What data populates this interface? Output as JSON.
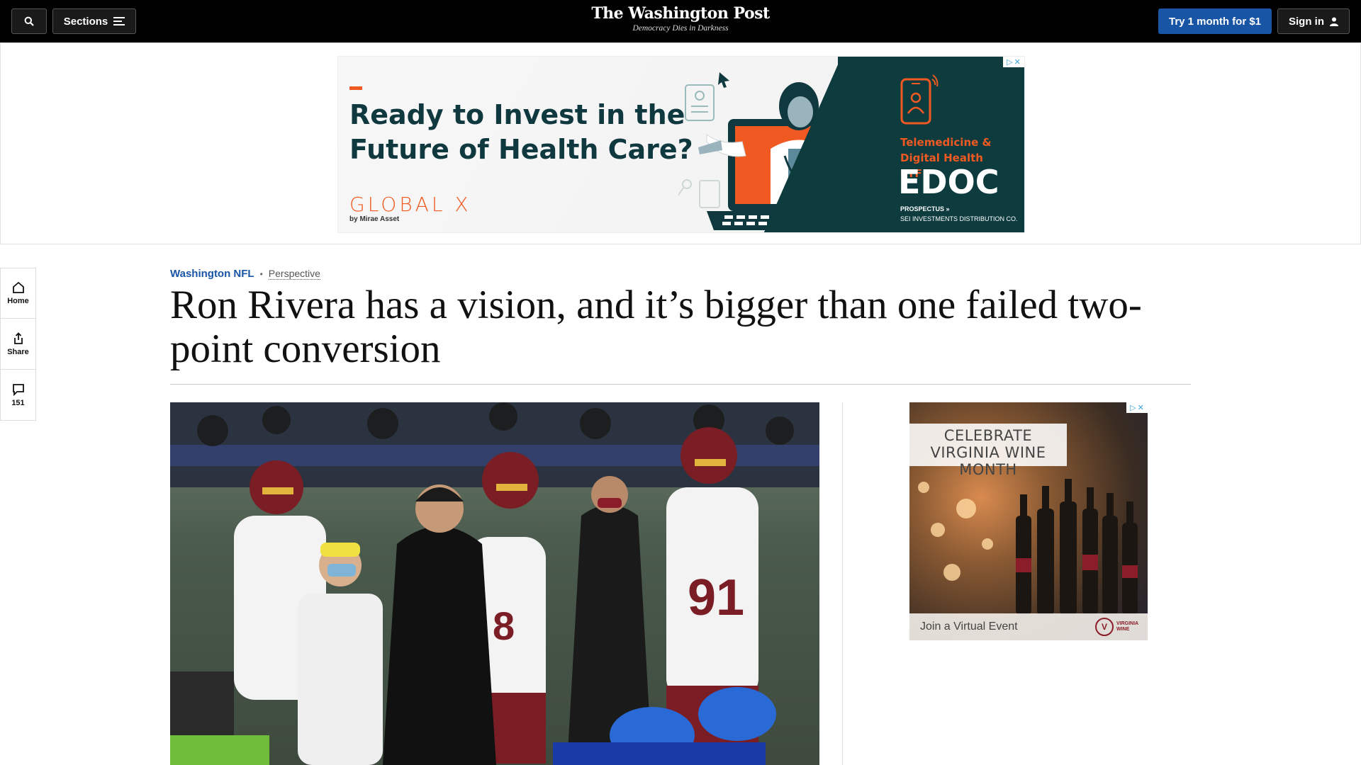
{
  "topbar": {
    "sections_label": "Sections",
    "logo": "The Washington Post",
    "tagline": "Democracy Dies in Darkness",
    "subscribe_label": "Try 1 month for $1",
    "signin_label": "Sign in"
  },
  "top_ad": {
    "headline": "Ready to Invest in the Future of Health Care?",
    "brand": "GLOBAL X",
    "brand_sub": "by Mirae Asset",
    "etf_name": "Telemedicine & Digital Health ETF",
    "ticker": "EDOC",
    "prospectus": "PROSPECTUS »",
    "distributor": "SEI INVESTMENTS DISTRIBUTION CO.",
    "colors": {
      "accent": "#f05a22",
      "dark": "#0d3b3e"
    }
  },
  "left_rail": {
    "home_label": "Home",
    "share_label": "Share",
    "comments_count": "151"
  },
  "article": {
    "section": "Washington NFL",
    "label": "Perspective",
    "headline": "Ron Rivera has a vision, and it’s bigger than one failed two-point conversion"
  },
  "side_ad": {
    "title": "CELEBRATE VIRGINIA WINE MONTH",
    "cta": "Join a Virtual Event",
    "logo_text": "VIRGINIA WINE"
  },
  "colors": {
    "nav_bg": "#000000",
    "subscribe_blue": "#1955a5",
    "section_blue": "#1955a5"
  }
}
